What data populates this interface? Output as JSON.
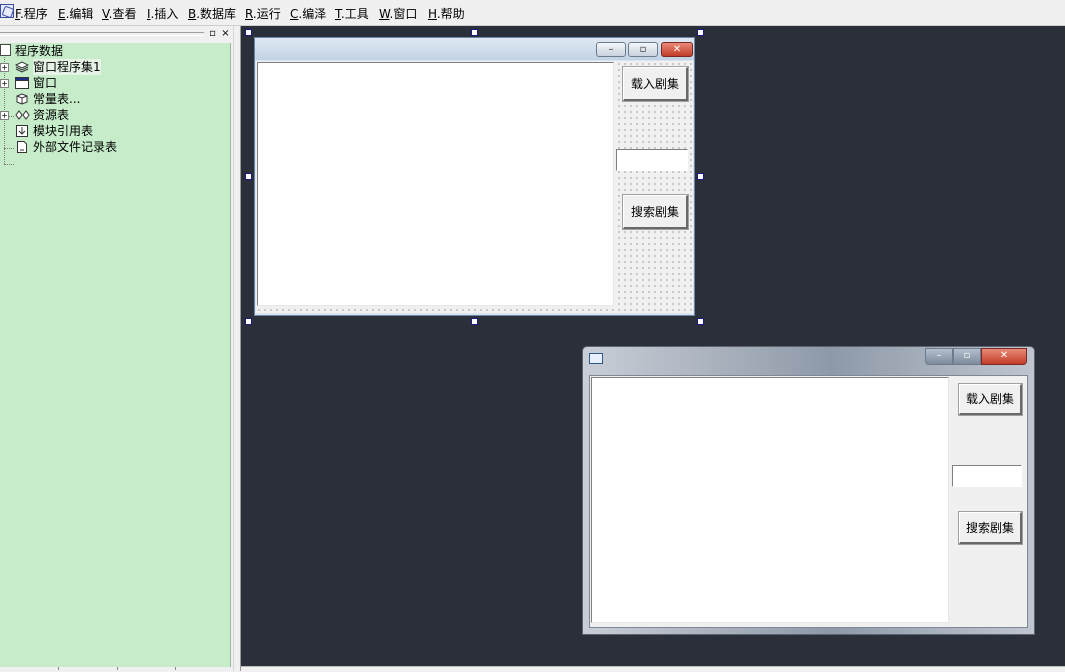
{
  "menu": {
    "items": [
      {
        "key": "F",
        "label": ".程序"
      },
      {
        "key": "E",
        "label": ".编辑"
      },
      {
        "key": "V",
        "label": ".查看"
      },
      {
        "key": "I",
        "label": ".插入"
      },
      {
        "key": "B",
        "label": ".数据库"
      },
      {
        "key": "R",
        "label": ".运行"
      },
      {
        "key": "C",
        "label": ".编泽"
      },
      {
        "key": "T",
        "label": ".工具"
      },
      {
        "key": "W",
        "label": ".窗口"
      },
      {
        "key": "H",
        "label": ".帮助"
      }
    ]
  },
  "panel": {
    "pin_glyph": "▫",
    "close_glyph": "×"
  },
  "tree": {
    "root": "程序数据",
    "items": [
      {
        "label": "窗口程序集1",
        "icon": "assembly-icon",
        "expandable": true
      },
      {
        "label": "窗口",
        "icon": "window-icon",
        "expandable": true
      },
      {
        "label": "常量表...",
        "icon": "constants-icon",
        "expandable": false
      },
      {
        "label": "资源表",
        "icon": "resources-icon",
        "expandable": true
      },
      {
        "label": "模块引用表",
        "icon": "module-icon",
        "expandable": false
      },
      {
        "label": "外部文件记录表",
        "icon": "external-file-icon",
        "expandable": false
      }
    ]
  },
  "design_form": {
    "load_button": "载入剧集",
    "search_button": "搜索剧集",
    "search_value": "",
    "caption_buttons": {
      "minimize": "–",
      "maximize": "▫",
      "close": "✕"
    }
  },
  "preview_form": {
    "load_button": "载入剧集",
    "search_button": "搜索剧集",
    "search_value": "",
    "caption_buttons": {
      "minimize": "–",
      "maximize": "▫",
      "close": "✕"
    }
  },
  "colors": {
    "workspace": "#2b2f3a",
    "tree_background": "#c6ecca",
    "selection_handle": "#1a1a80"
  }
}
